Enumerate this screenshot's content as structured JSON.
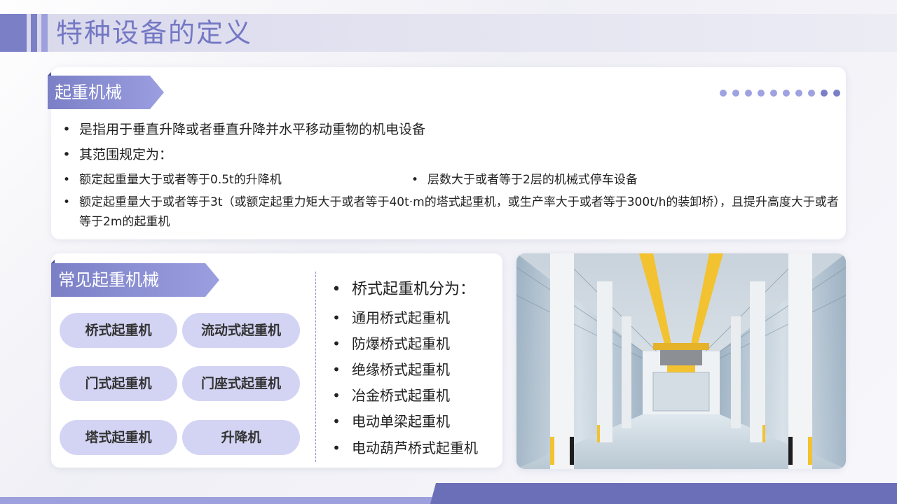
{
  "title": "特种设备的定义",
  "section1": {
    "tag": "起重机械",
    "bullet_symbol": "•",
    "lines": [
      "是指用于垂直升降或者垂直升降并水平移动重物的机电设备",
      "其范围规定为："
    ],
    "rule_left": "额定起重量大于或者等于0.5t的升降机",
    "rule_right": "层数大于或者等于2层的机械式停车设备",
    "rule_long": "额定起重量大于或者等于3t（或额定起重力矩大于或者等于40t·m的塔式起重机，或生产率大于或者等于300t/h的装卸桥），且提升高度大于或者等于2m的起重机"
  },
  "section2": {
    "tag": "常见起重机械",
    "pills": [
      "桥式起重机",
      "流动式起重机",
      "门式起重机",
      "门座式起重机",
      "塔式起重机",
      "升降机"
    ],
    "list_head": "桥式起重机分为：",
    "list": [
      "通用桥式起重机",
      "防爆桥式起重机",
      "绝缘桥式起重机",
      "冶金桥式起重机",
      "电动单梁起重机",
      "电动葫芦桥式起重机"
    ]
  },
  "colors": {
    "accent": "#7b7fc6",
    "accent_light": "#9da0dc",
    "pill_bg": "#d3d4f4",
    "beam_yellow": "#f2c230"
  },
  "icons": [
    "warehouse-photo"
  ]
}
